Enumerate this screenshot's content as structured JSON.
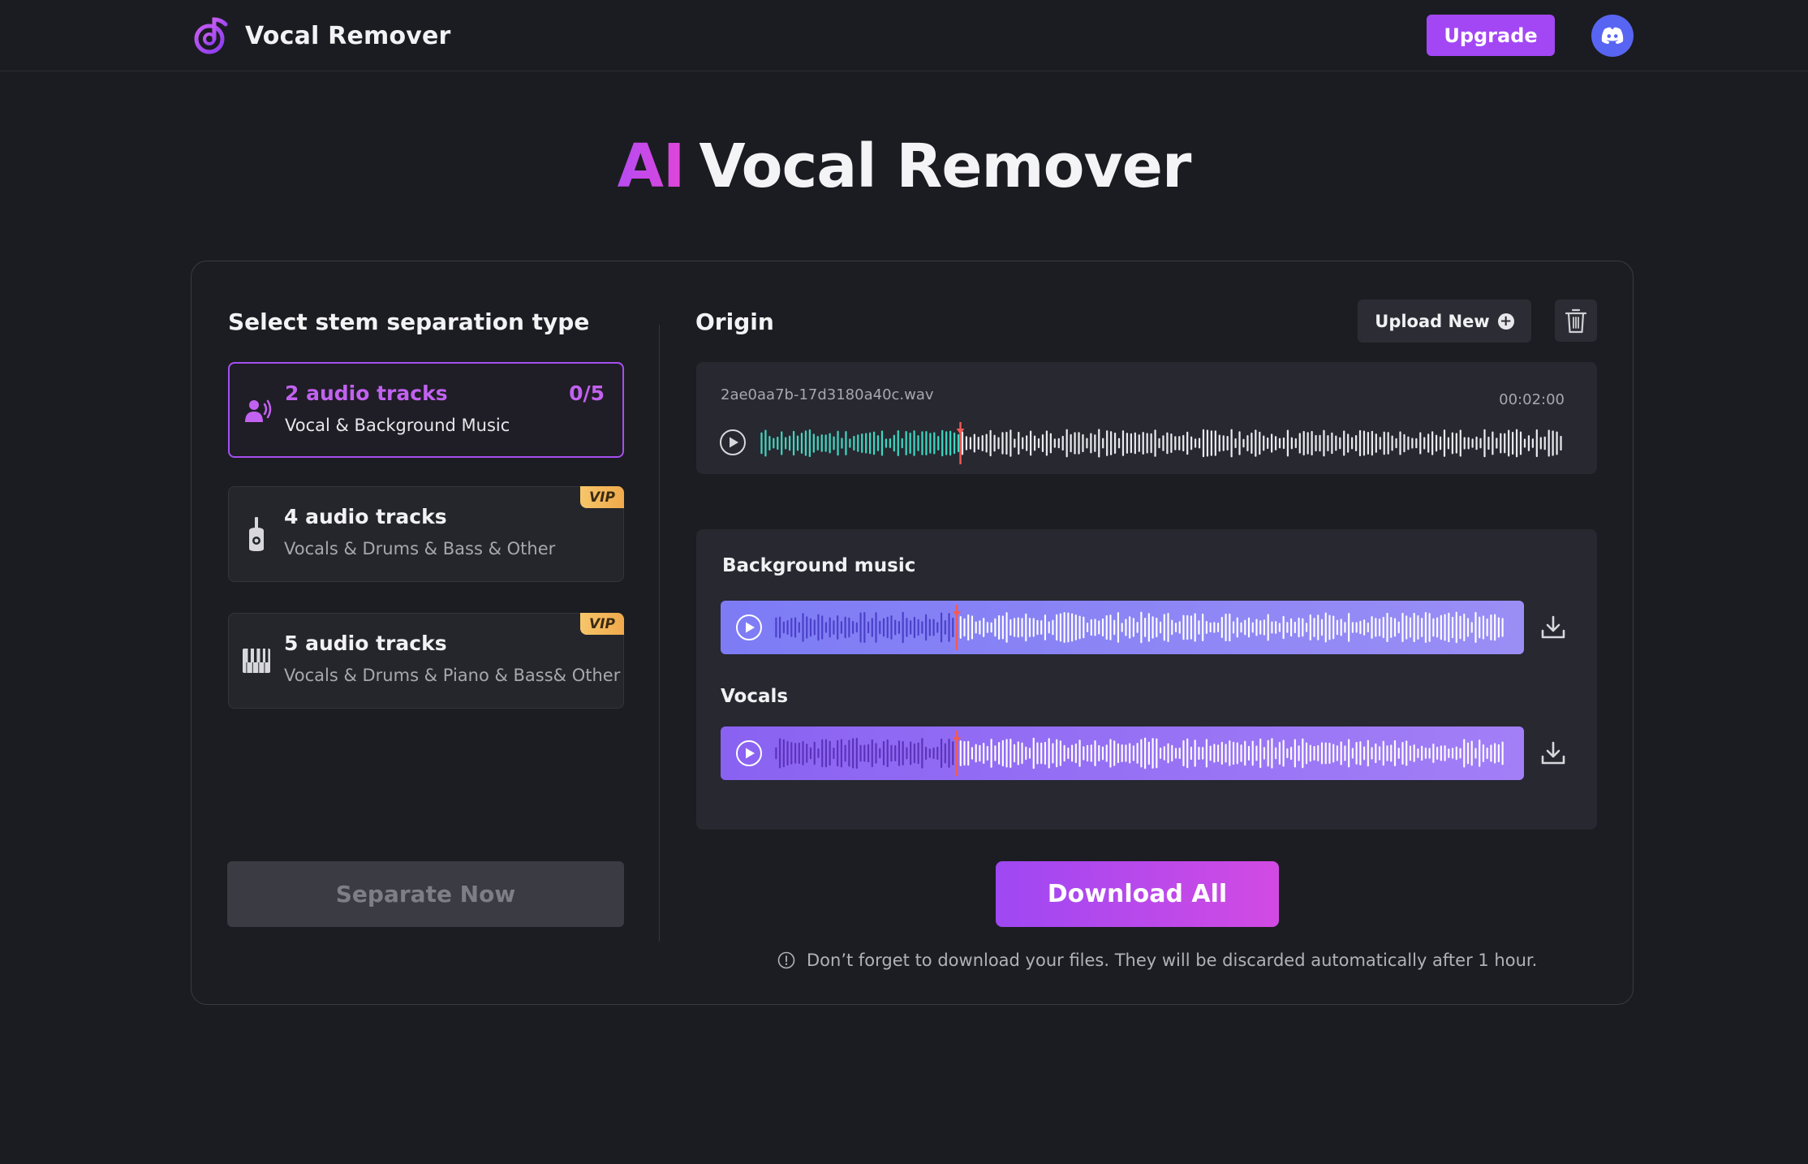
{
  "header": {
    "app_name": "Vocal Remover",
    "upgrade_label": "Upgrade",
    "logo_icon": "music-note-logo-icon",
    "discord_icon": "discord-icon"
  },
  "hero": {
    "accent": "AI",
    "title_rest": "Vocal Remover"
  },
  "left": {
    "title": "Select stem separation type",
    "options": [
      {
        "title": "2 audio tracks",
        "subtitle": "Vocal & Background Music",
        "count": "0/5",
        "icon": "vocal-person-icon",
        "selected": true
      },
      {
        "title": "4 audio tracks",
        "subtitle": "Vocals & Drums & Bass & Other",
        "badge": "VIP",
        "icon": "guitar-icon"
      },
      {
        "title": "5 audio tracks",
        "subtitle": "Vocals & Drums & Piano & Bass& Other",
        "badge": "VIP",
        "icon": "piano-icon"
      }
    ],
    "separate_label": "Separate Now"
  },
  "origin": {
    "title": "Origin",
    "upload_label": "Upload New",
    "filename": "2ae0aa7b-17d3180a40c.wav",
    "duration": "00:02:00",
    "progress": 0.25
  },
  "results": {
    "tracks": [
      {
        "label": "Background music",
        "progress": 0.25
      },
      {
        "label": "Vocals",
        "progress": 0.25
      }
    ]
  },
  "download_all_label": "Download All",
  "notice": "Don’t forget to download your files. They will be discarded automatically after 1 hour.",
  "colors": {
    "accent": "#a347f5",
    "origin_played": "#3fd6c0",
    "playhead": "#f25a55",
    "discord": "#5865f2",
    "vip": "#f6c66a"
  }
}
